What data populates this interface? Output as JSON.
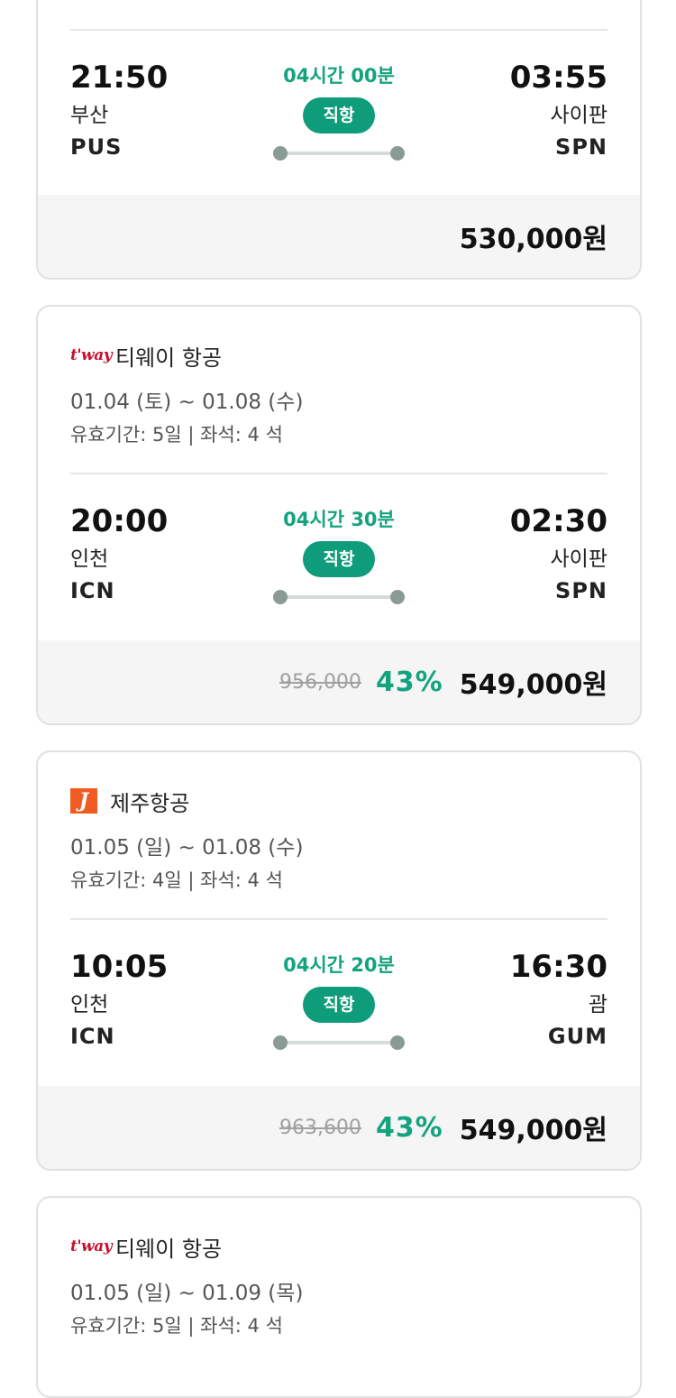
{
  "flights": [
    {
      "departure": {
        "time": "21:50",
        "city": "부산",
        "code": "PUS"
      },
      "duration": "04시간 00분",
      "badge": "직항",
      "arrival": {
        "time": "03:55",
        "city": "사이판",
        "code": "SPN"
      },
      "price": "530,000원"
    },
    {
      "airline": {
        "logo_text": "t'way",
        "name": "티웨이 항공"
      },
      "dates": "01.04 (토) ~ 01.08 (수)",
      "validity": "유효기간: 5일 | 좌석: 4 석",
      "departure": {
        "time": "20:00",
        "city": "인천",
        "code": "ICN"
      },
      "duration": "04시간 30분",
      "badge": "직항",
      "arrival": {
        "time": "02:30",
        "city": "사이판",
        "code": "SPN"
      },
      "original_price": "956,000",
      "discount": "43%",
      "price": "549,000원"
    },
    {
      "airline": {
        "logo_text": "J",
        "name": "제주항공"
      },
      "dates": "01.05 (일) ~ 01.08 (수)",
      "validity": "유효기간: 4일 | 좌석: 4 석",
      "departure": {
        "time": "10:05",
        "city": "인천",
        "code": "ICN"
      },
      "duration": "04시간 20분",
      "badge": "직항",
      "arrival": {
        "time": "16:30",
        "city": "괌",
        "code": "GUM"
      },
      "original_price": "963,600",
      "discount": "43%",
      "price": "549,000원"
    },
    {
      "airline": {
        "logo_text": "t'way",
        "name": "티웨이 항공"
      },
      "dates": "01.05 (일) ~ 01.09 (목)",
      "validity": "유효기간: 5일 | 좌석: 4 석"
    }
  ],
  "colors": {
    "accent_green": "#14a37f",
    "badge_green": "#0e9c7a",
    "tway_red": "#c8102e",
    "jeju_orange": "#f15a22",
    "price_bar_bg": "#f5f5f5"
  },
  "icons": {
    "tway": "tway-logo",
    "jeju": "jejuair-logo"
  }
}
